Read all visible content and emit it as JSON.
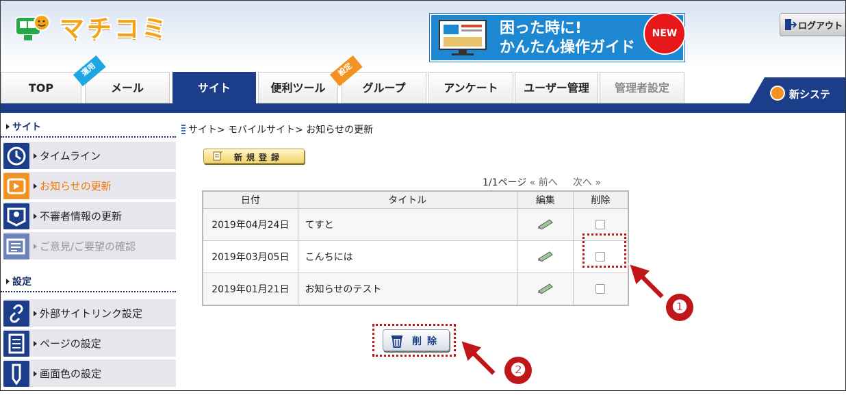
{
  "header": {
    "logo_text": "マチコミ",
    "banner": {
      "line1": "困った時に!",
      "line2": "かんたん操作ガイド",
      "badge": "NEW"
    },
    "logout_label": "ログアウト"
  },
  "nav": {
    "tabs": [
      {
        "label": "TOP",
        "state": "normal"
      },
      {
        "label": "メール",
        "state": "normal",
        "ribbon": "運用"
      },
      {
        "label": "サイト",
        "state": "active"
      },
      {
        "label": "便利ツール",
        "state": "normal"
      },
      {
        "label": "グループ",
        "state": "normal",
        "ribbon": "設定"
      },
      {
        "label": "アンケート",
        "state": "normal"
      },
      {
        "label": "ユーザー管理",
        "state": "normal"
      },
      {
        "label": "管理者設定",
        "state": "disabled"
      }
    ],
    "new_system_label": "新システ"
  },
  "sidebar": {
    "site_heading": "サイト",
    "site_items": [
      {
        "label": "タイムライン",
        "icon": "clock-icon"
      },
      {
        "label": "お知らせの更新",
        "icon": "notice-icon",
        "state": "current"
      },
      {
        "label": "不審者情報の更新",
        "icon": "suspicious-person-icon"
      },
      {
        "label": "ご意見/ご要望の確認",
        "icon": "feedback-icon",
        "state": "disabled"
      }
    ],
    "settings_heading": "設定",
    "settings_items": [
      {
        "label": "外部サイトリンク設定",
        "icon": "link-icon"
      },
      {
        "label": "ページの設定",
        "icon": "page-icon"
      },
      {
        "label": "画面色の設定",
        "icon": "pencil-icon"
      }
    ]
  },
  "main": {
    "breadcrumb": "サイト> モバイルサイト> お知らせの更新",
    "new_button_label": "新規登録",
    "pager": {
      "page_info": "1/1ページ",
      "prev": "前へ",
      "next": "次へ"
    },
    "table": {
      "headers": {
        "date": "日付",
        "title": "タイトル",
        "edit": "編集",
        "delete": "削除"
      },
      "rows": [
        {
          "date": "2019年04月24日",
          "title": "てすと"
        },
        {
          "date": "2019年03月05日",
          "title": "こんちには"
        },
        {
          "date": "2019年01月21日",
          "title": "お知らせのテスト"
        }
      ]
    },
    "delete_button_label": "削除"
  },
  "annotations": {
    "marker1": "❶",
    "marker2": "❷"
  },
  "colors": {
    "nav_blue": "#1b3d8a",
    "accent_orange": "#f29221",
    "highlight_red": "#c0161a"
  }
}
